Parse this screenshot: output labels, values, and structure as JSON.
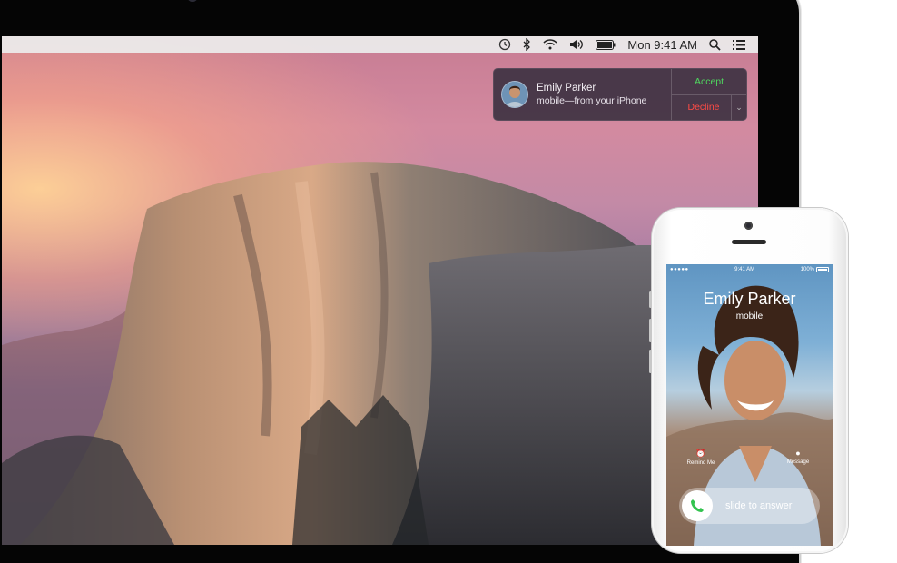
{
  "menubar": {
    "time_machine_icon": "time-machine-icon",
    "bluetooth_icon": "bluetooth-icon",
    "wifi_icon": "wifi-icon",
    "volume_icon": "volume-icon",
    "battery_icon": "battery-icon",
    "clock": "Mon 9:41 AM",
    "spotlight_icon": "search-icon",
    "notification_center_icon": "list-icon"
  },
  "notification": {
    "caller_name": "Emily Parker",
    "subtitle": "mobile—from your iPhone",
    "accept_label": "Accept",
    "decline_label": "Decline",
    "accept_color": "#4fd65f",
    "decline_color": "#ff4b45"
  },
  "iphone": {
    "status_time": "9:41 AM",
    "status_battery": "100%",
    "caller_name": "Emily Parker",
    "caller_type": "mobile",
    "remind_label": "Remind Me",
    "message_label": "Message",
    "slide_label": "slide to answer",
    "answer_icon": "phone-icon"
  }
}
